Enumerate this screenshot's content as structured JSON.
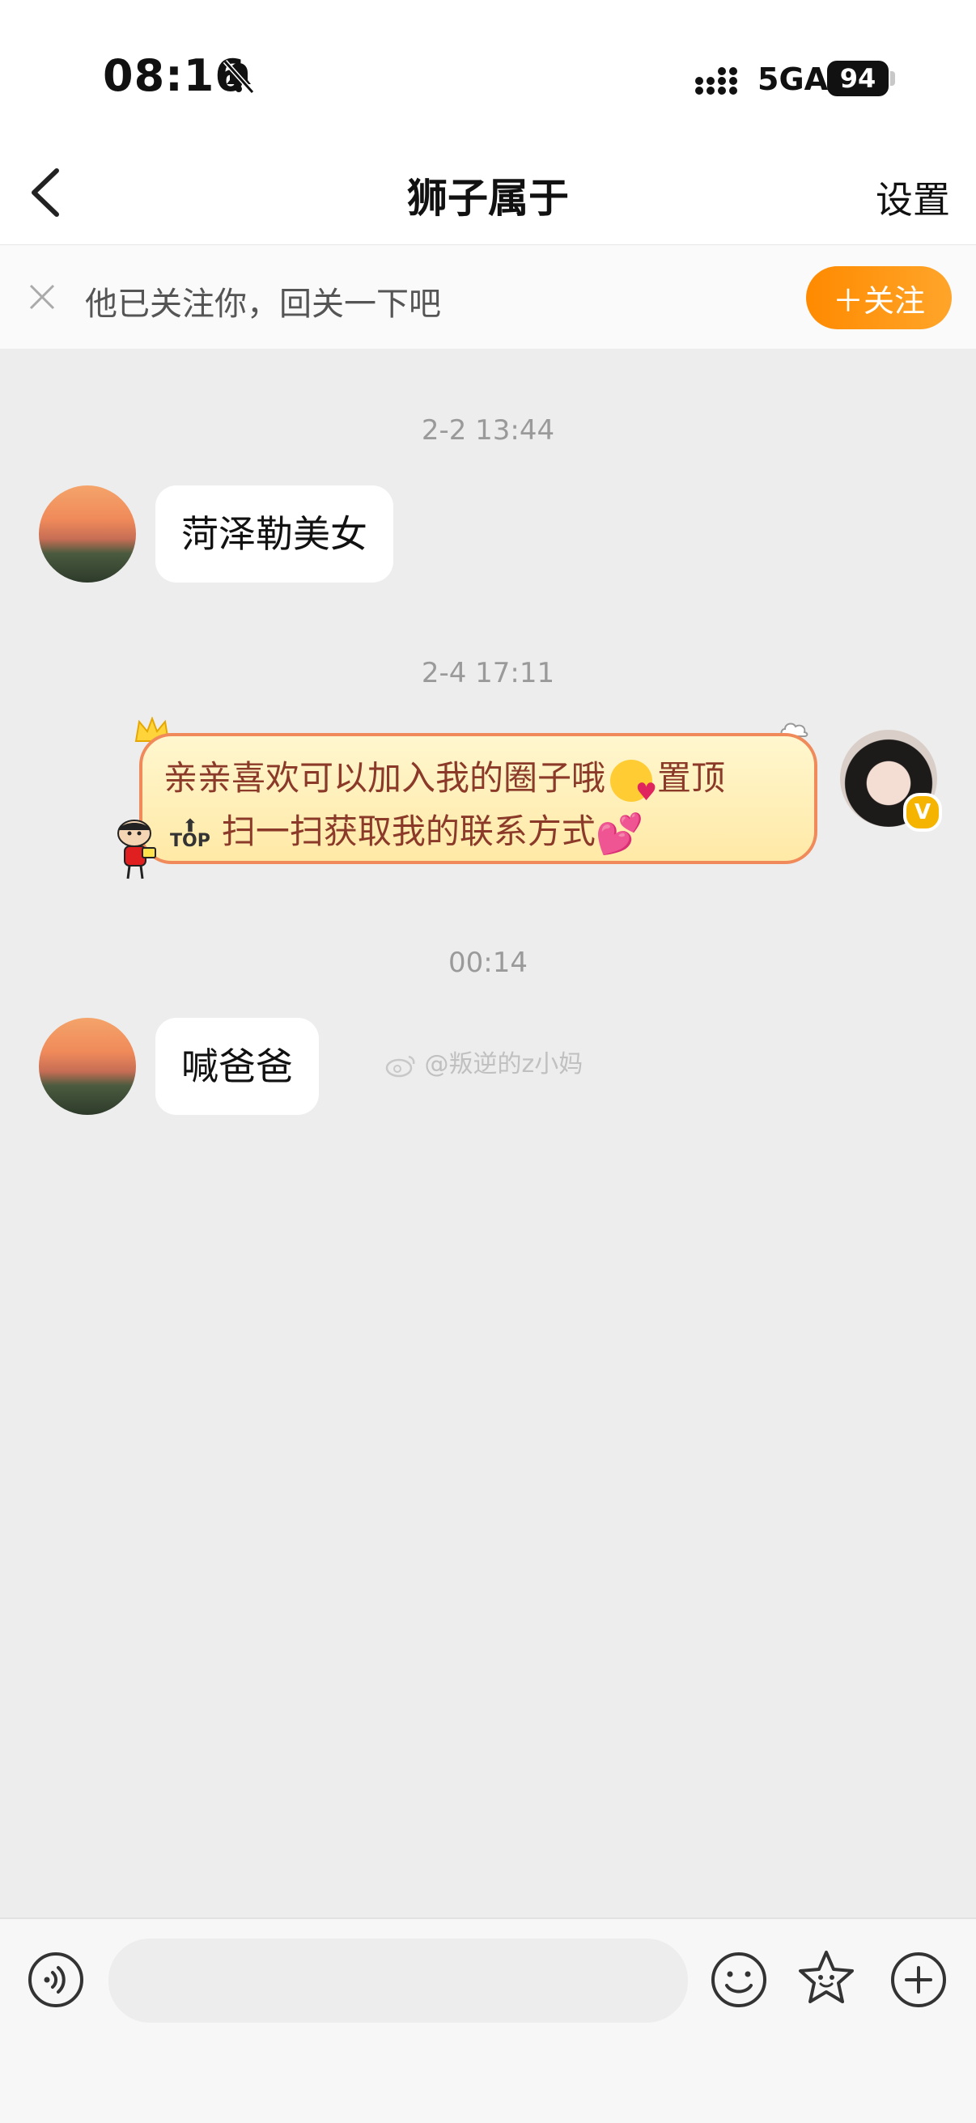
{
  "status_bar": {
    "time": "08:16",
    "network": "5GA",
    "battery": "94"
  },
  "nav": {
    "title": "狮子属于",
    "settings_label": "设置"
  },
  "follow_banner": {
    "text": "他已关注你，回关一下吧",
    "button_label": "＋关注"
  },
  "messages": [
    {
      "timestamp": "2-2 13:44",
      "text": "菏泽勒美女",
      "sender": "other"
    },
    {
      "timestamp": "2-4 17:11",
      "line1": "亲亲喜欢可以加入我的圈子哦",
      "line1_suffix": "置顶",
      "top_label": "TOP",
      "line2": "扫一扫获取我的联系方式",
      "sender": "self"
    },
    {
      "timestamp": "00:14",
      "text": "喊爸爸",
      "sender": "other"
    }
  ],
  "watermark": "@叛逆的z小妈",
  "input_bar": {
    "icons": [
      "voice-icon",
      "emoji-icon",
      "sticker-icon",
      "plus-icon"
    ]
  },
  "colors": {
    "accent": "#ff8a00",
    "background": "#ededed",
    "bubble_text_special": "#8b3a2a"
  }
}
